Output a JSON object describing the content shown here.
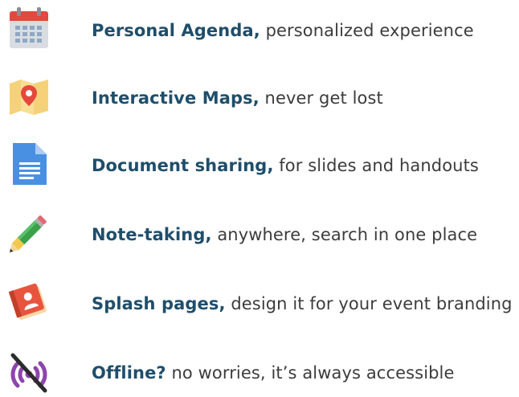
{
  "features": [
    {
      "icon": "calendar-icon",
      "heading": "Personal Agenda,",
      "detail": " personalized experience"
    },
    {
      "icon": "map-pin-icon",
      "heading": "Interactive Maps,",
      "detail": " never get lost"
    },
    {
      "icon": "document-icon",
      "heading": "Document sharing,",
      "detail": " for slides and handouts"
    },
    {
      "icon": "pencil-icon",
      "heading": "Note-taking,",
      "detail": " anywhere, search in one place"
    },
    {
      "icon": "splash-book-icon",
      "heading": "Splash pages,",
      "detail": " design it for your event branding"
    },
    {
      "icon": "offline-wifi-icon",
      "heading": "Offline?",
      "detail": " no worries, it’s always accessible"
    }
  ]
}
